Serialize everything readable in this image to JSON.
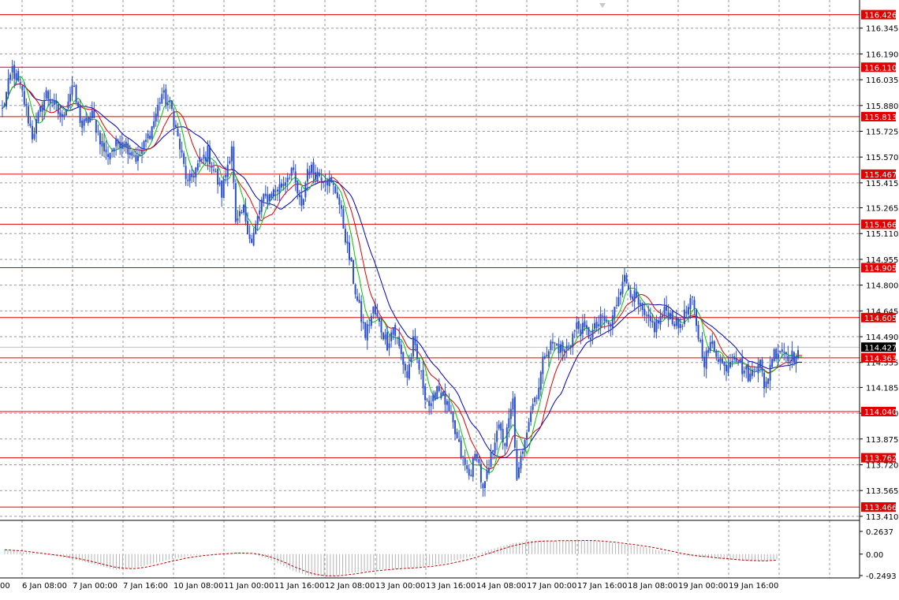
{
  "chart_data": [
    {
      "type": "candlestick",
      "title": "",
      "xlabel": "",
      "ylabel": "",
      "ylim": [
        113.4,
        116.5
      ],
      "y_ticks": [
        "116.345",
        "116.190",
        "116.035",
        "115.880",
        "115.725",
        "115.570",
        "115.415",
        "115.265",
        "115.110",
        "114.955",
        "114.800",
        "114.645",
        "114.490",
        "114.335",
        "114.185",
        "114.030",
        "113.875",
        "113.720",
        "113.565",
        "113.410"
      ],
      "x_ticks": [
        "00",
        "6 Jan 08:00",
        "7 Jan 00:00",
        "7 Jan 16:00",
        "10 Jan 08:00",
        "11 Jan 00:00",
        "11 Jan 16:00",
        "12 Jan 08:00",
        "13 Jan 00:00",
        "13 Jan 16:00",
        "14 Jan 08:00",
        "17 Jan 00:00",
        "17 Jan 16:00",
        "18 Jan 08:00",
        "19 Jan 00:00",
        "19 Jan 16:00"
      ],
      "price_lines": [
        "116.426",
        "116.110",
        "115.813",
        "115.467",
        "115.166",
        "114.905",
        "114.605",
        "114.363",
        "114.040",
        "113.762",
        "113.466"
      ],
      "current_price": "114.427",
      "grid": true,
      "colors": {
        "candles": "#2a4fd0",
        "ma_fast": "#00c800",
        "ma_mid": "#e00000",
        "ma_slow": "#0000b4",
        "levels": "#e00000",
        "grid": "#9a9a9a"
      },
      "close_path": [
        [
          0,
          115.85
        ],
        [
          5,
          116.1
        ],
        [
          10,
          115.95
        ],
        [
          15,
          115.7
        ],
        [
          22,
          115.95
        ],
        [
          30,
          115.8
        ],
        [
          35,
          116.0
        ],
        [
          40,
          115.75
        ],
        [
          45,
          115.82
        ],
        [
          52,
          115.58
        ],
        [
          60,
          115.68
        ],
        [
          68,
          115.55
        ],
        [
          75,
          115.75
        ],
        [
          80,
          115.95
        ],
        [
          85,
          115.85
        ],
        [
          93,
          115.4
        ],
        [
          97,
          115.5
        ],
        [
          103,
          115.6
        ],
        [
          110,
          115.35
        ],
        [
          115,
          115.65
        ],
        [
          117,
          115.15
        ],
        [
          121,
          115.25
        ],
        [
          125,
          115.05
        ],
        [
          130,
          115.3
        ],
        [
          140,
          115.4
        ],
        [
          145,
          115.5
        ],
        [
          150,
          115.25
        ],
        [
          153,
          115.5
        ],
        [
          162,
          115.45
        ],
        [
          168,
          115.35
        ],
        [
          175,
          114.9
        ],
        [
          178,
          114.7
        ],
        [
          182,
          114.5
        ],
        [
          186,
          114.65
        ],
        [
          193,
          114.45
        ],
        [
          196,
          114.55
        ],
        [
          203,
          114.25
        ],
        [
          206,
          114.45
        ],
        [
          212,
          114.15
        ],
        [
          215,
          114.05
        ],
        [
          218,
          114.2
        ],
        [
          222,
          114.1
        ],
        [
          226,
          113.95
        ],
        [
          230,
          113.78
        ],
        [
          234,
          113.65
        ],
        [
          238,
          113.8
        ],
        [
          241,
          113.55
        ],
        [
          244,
          113.7
        ],
        [
          248,
          113.95
        ],
        [
          252,
          113.85
        ],
        [
          256,
          114.1
        ],
        [
          258,
          113.6
        ],
        [
          262,
          113.9
        ],
        [
          265,
          114.05
        ],
        [
          269,
          114.2
        ],
        [
          272,
          114.4
        ],
        [
          276,
          114.45
        ],
        [
          282,
          114.4
        ],
        [
          288,
          114.55
        ],
        [
          295,
          114.5
        ],
        [
          301,
          114.6
        ],
        [
          305,
          114.55
        ],
        [
          311,
          114.85
        ],
        [
          316,
          114.75
        ],
        [
          322,
          114.6
        ],
        [
          327,
          114.55
        ],
        [
          333,
          114.65
        ],
        [
          339,
          114.55
        ],
        [
          346,
          114.7
        ],
        [
          349,
          114.5
        ],
        [
          352,
          114.35
        ],
        [
          356,
          114.45
        ],
        [
          362,
          114.3
        ],
        [
          367,
          114.4
        ],
        [
          371,
          114.3
        ],
        [
          375,
          114.25
        ],
        [
          380,
          114.38
        ],
        [
          382,
          114.15
        ],
        [
          386,
          114.38
        ],
        [
          390,
          114.42
        ],
        [
          394,
          114.38
        ],
        [
          396,
          114.37
        ]
      ],
      "indicator": {
        "type": "histogram",
        "y_ticks": [
          "0.2637",
          "0.00",
          "-0.2493"
        ],
        "values": [
          0.05,
          0.03,
          0.01,
          -0.01,
          -0.03,
          -0.06,
          -0.1,
          -0.14,
          -0.18,
          -0.17,
          -0.14,
          -0.1,
          -0.06,
          -0.03,
          -0.01,
          0.0,
          0.01,
          0.02,
          0.0,
          -0.05,
          -0.12,
          -0.2,
          -0.25,
          -0.26,
          -0.25,
          -0.22,
          -0.2,
          -0.18,
          -0.17,
          -0.16,
          -0.15,
          -0.13,
          -0.1,
          -0.06,
          -0.02,
          0.04,
          0.09,
          0.13,
          0.15,
          0.16,
          0.15,
          0.16,
          0.16,
          0.15,
          0.13,
          0.11,
          0.09,
          0.06,
          0.02,
          -0.01,
          -0.03,
          -0.04,
          -0.06,
          -0.07,
          -0.08,
          -0.08,
          -0.06
        ]
      }
    }
  ]
}
